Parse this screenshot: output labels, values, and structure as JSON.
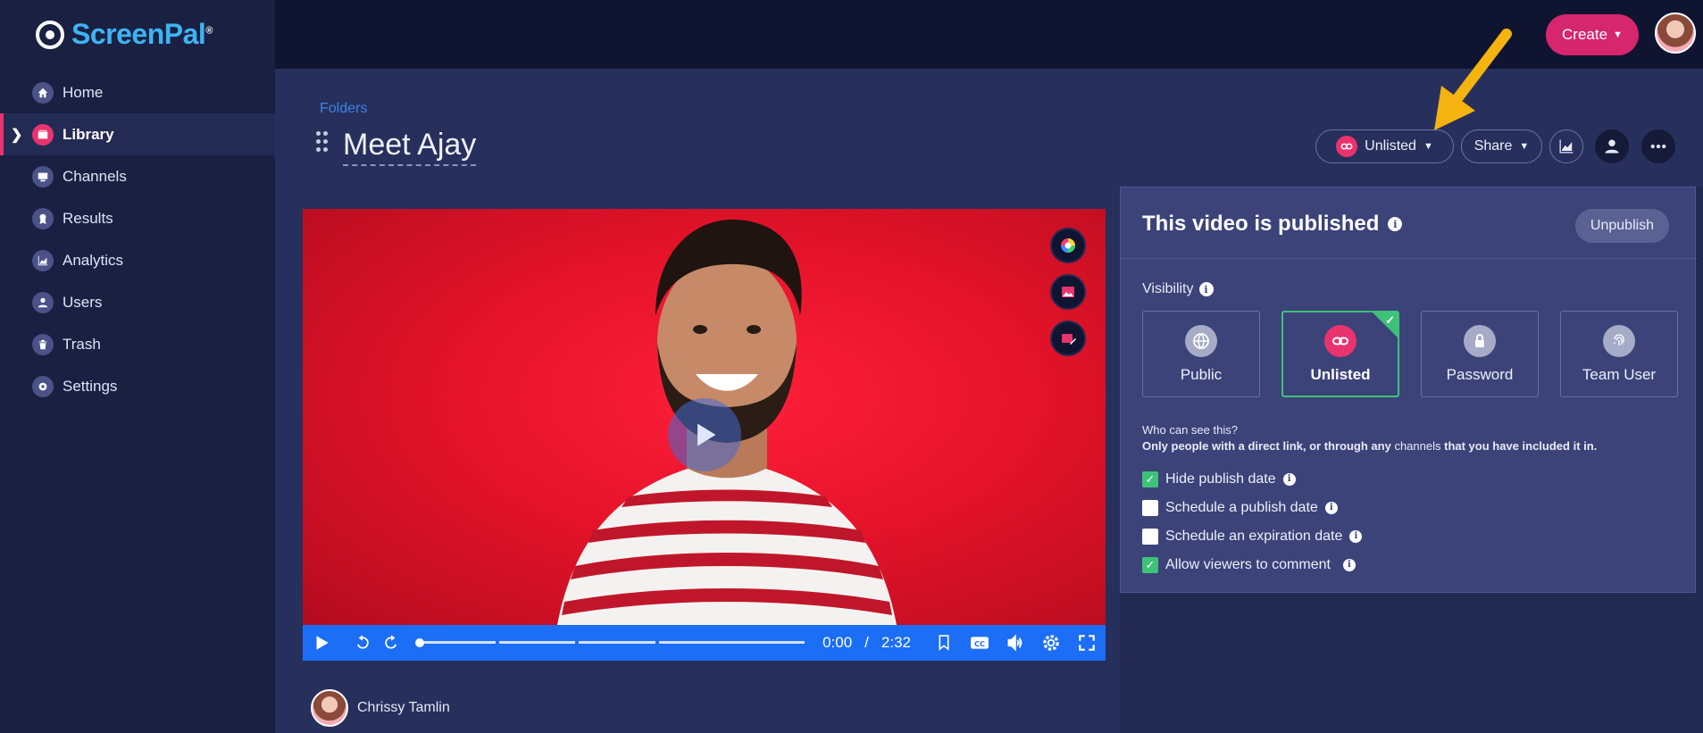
{
  "app": {
    "logo_part1": "Screen",
    "logo_part2": "Pal",
    "logo_mark": "®"
  },
  "sidebar": {
    "items": [
      {
        "label": "Home",
        "icon": "home-icon"
      },
      {
        "label": "Library",
        "icon": "library-icon",
        "active": true
      },
      {
        "label": "Channels",
        "icon": "channels-icon"
      },
      {
        "label": "Results",
        "icon": "results-icon"
      },
      {
        "label": "Analytics",
        "icon": "analytics-icon"
      },
      {
        "label": "Users",
        "icon": "users-icon"
      },
      {
        "label": "Trash",
        "icon": "trash-icon"
      },
      {
        "label": "Settings",
        "icon": "settings-icon"
      }
    ]
  },
  "topbar": {
    "create_label": "Create"
  },
  "header": {
    "breadcrumb": "Folders",
    "title": "Meet Ajay",
    "visibility_label": "Unlisted",
    "share_label": "Share"
  },
  "player": {
    "current_time": "0:00",
    "separator": "/",
    "duration": "2:32",
    "progress": 0
  },
  "author": {
    "name": "Chrissy Tamlin"
  },
  "panel": {
    "title": "This video is published",
    "unpublish_label": "Unpublish",
    "visibility_heading": "Visibility",
    "options": [
      {
        "label": "Public",
        "icon": "globe-icon"
      },
      {
        "label": "Unlisted",
        "icon": "link-icon",
        "selected": true
      },
      {
        "label": "Password",
        "icon": "lock-icon"
      },
      {
        "label": "Team User",
        "icon": "fingerprint-icon"
      }
    ],
    "who_question": "Who can see this?",
    "who_answer_part1": "Only people with a direct link, or through any",
    "who_answer_link": "channels",
    "who_answer_part2": "that you have included it in.",
    "checkboxes": [
      {
        "label": "Hide publish date",
        "checked": true
      },
      {
        "label": "Schedule a publish date",
        "checked": false
      },
      {
        "label": "Schedule an expiration date",
        "checked": false
      },
      {
        "label": "Allow viewers to comment",
        "checked": true
      }
    ]
  },
  "colors": {
    "accent_pink": "#e8336f",
    "create_pink": "#d6266d",
    "player_blue": "#1b6ef5",
    "check_green": "#3ec278",
    "annotation_arrow": "#f5b30f"
  }
}
